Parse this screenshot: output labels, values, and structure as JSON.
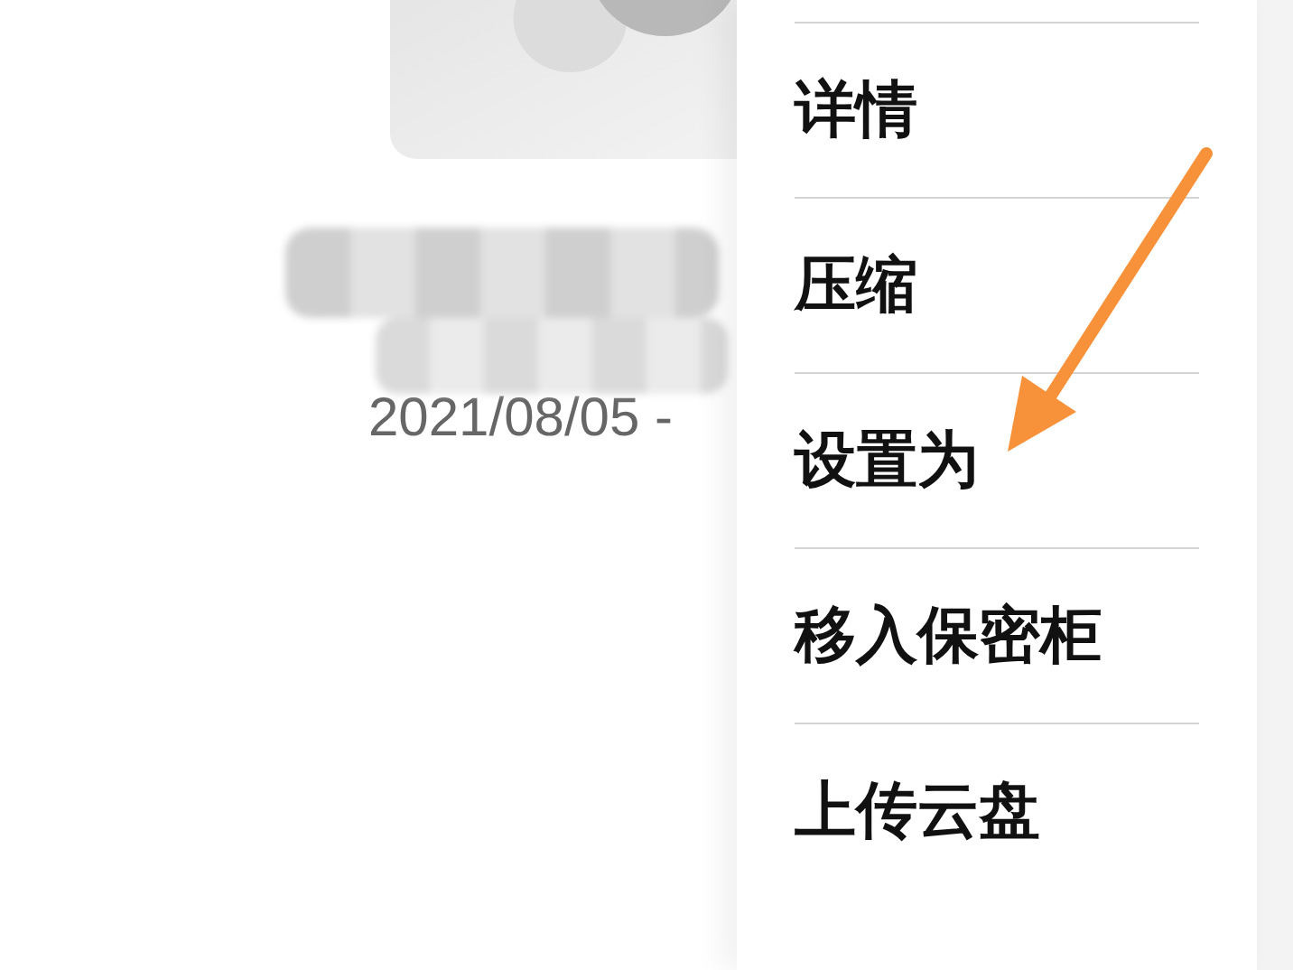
{
  "file": {
    "date": "2021/08/05 -"
  },
  "menu": {
    "items": [
      {
        "label": "详情"
      },
      {
        "label": "压缩"
      },
      {
        "label": "设置为"
      },
      {
        "label": "移入保密柜"
      },
      {
        "label": "上传云盘"
      }
    ]
  }
}
